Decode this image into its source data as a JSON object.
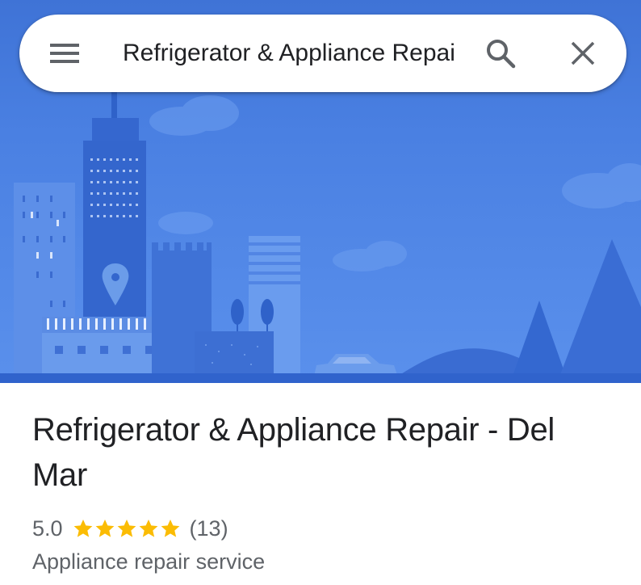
{
  "search": {
    "query": "Refrigerator & Appliance Repair - Del Mar"
  },
  "place": {
    "name": "Refrigerator & Appliance Repair - Del Mar",
    "rating": "5.0",
    "stars": 5,
    "review_count": "(13)",
    "category": "Appliance repair service"
  },
  "icons": {
    "menu": "hamburger-menu-icon",
    "search": "search-icon",
    "close": "close-icon",
    "star": "star-icon",
    "location_pin": "location-pin-icon"
  },
  "colors": {
    "hero_sky": "#4a80e2",
    "star": "#fbbc04",
    "text_primary": "#202124",
    "text_secondary": "#5f6368"
  }
}
